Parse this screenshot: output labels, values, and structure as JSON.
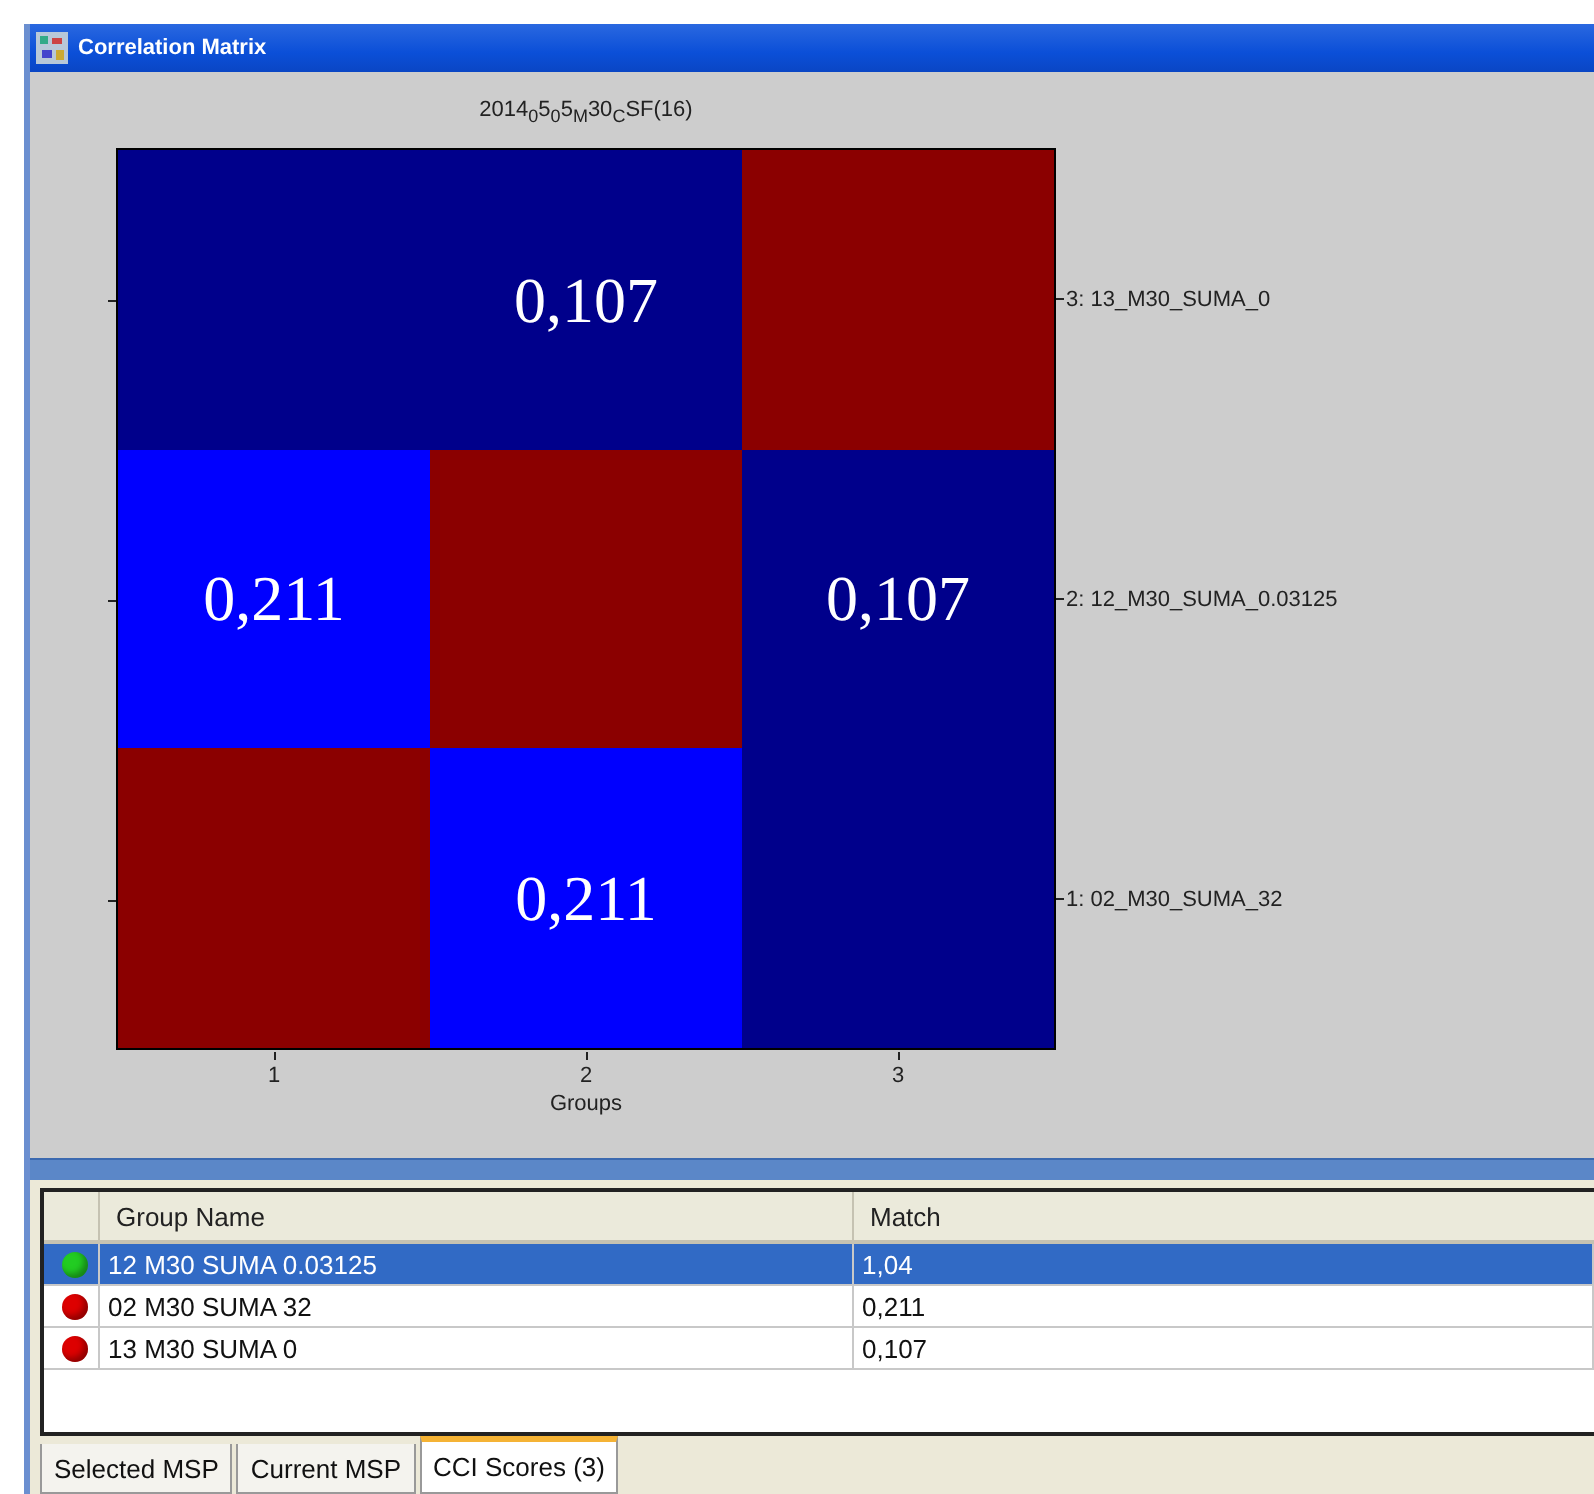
{
  "window": {
    "title": "Correlation Matrix"
  },
  "chart": {
    "title": "2014$_{0}$5$_{0}$5$_{M}$30$_{C}$SF(16)",
    "xlabel": "Groups",
    "xticks": [
      "1",
      "2",
      "3"
    ],
    "rows": [
      {
        "label": "3: 13_M30_SUMA_0",
        "cells": [
          {
            "color": "#00008b"
          },
          {
            "color": "#00008b",
            "value": "0,107"
          },
          {
            "color": "#8b0000"
          }
        ]
      },
      {
        "label": "2: 12_M30_SUMA_0.03125",
        "cells": [
          {
            "color": "#0000ff",
            "value": "0,211"
          },
          {
            "color": "#8b0000"
          },
          {
            "color": "#00008b",
            "value": "0,107"
          }
        ]
      },
      {
        "label": "1: 02_M30_SUMA_32",
        "cells": [
          {
            "color": "#8b0000"
          },
          {
            "color": "#0000ff",
            "value": "0,211"
          },
          {
            "color": "#00008b"
          }
        ]
      }
    ]
  },
  "table": {
    "columns": [
      "Group Name",
      "Match"
    ],
    "rows": [
      {
        "color": "#22cc22",
        "name": "12 M30 SUMA 0.03125",
        "match": "1,04",
        "selected": true
      },
      {
        "color": "#dd0000",
        "name": "02 M30 SUMA 32",
        "match": "0,211",
        "selected": false
      },
      {
        "color": "#dd0000",
        "name": "13 M30 SUMA 0",
        "match": "0,107",
        "selected": false
      }
    ]
  },
  "tabs": [
    {
      "label": "Selected MSP",
      "selected": false
    },
    {
      "label": "Current MSP",
      "selected": false
    },
    {
      "label": "CCI Scores (3)",
      "selected": true
    }
  ]
}
